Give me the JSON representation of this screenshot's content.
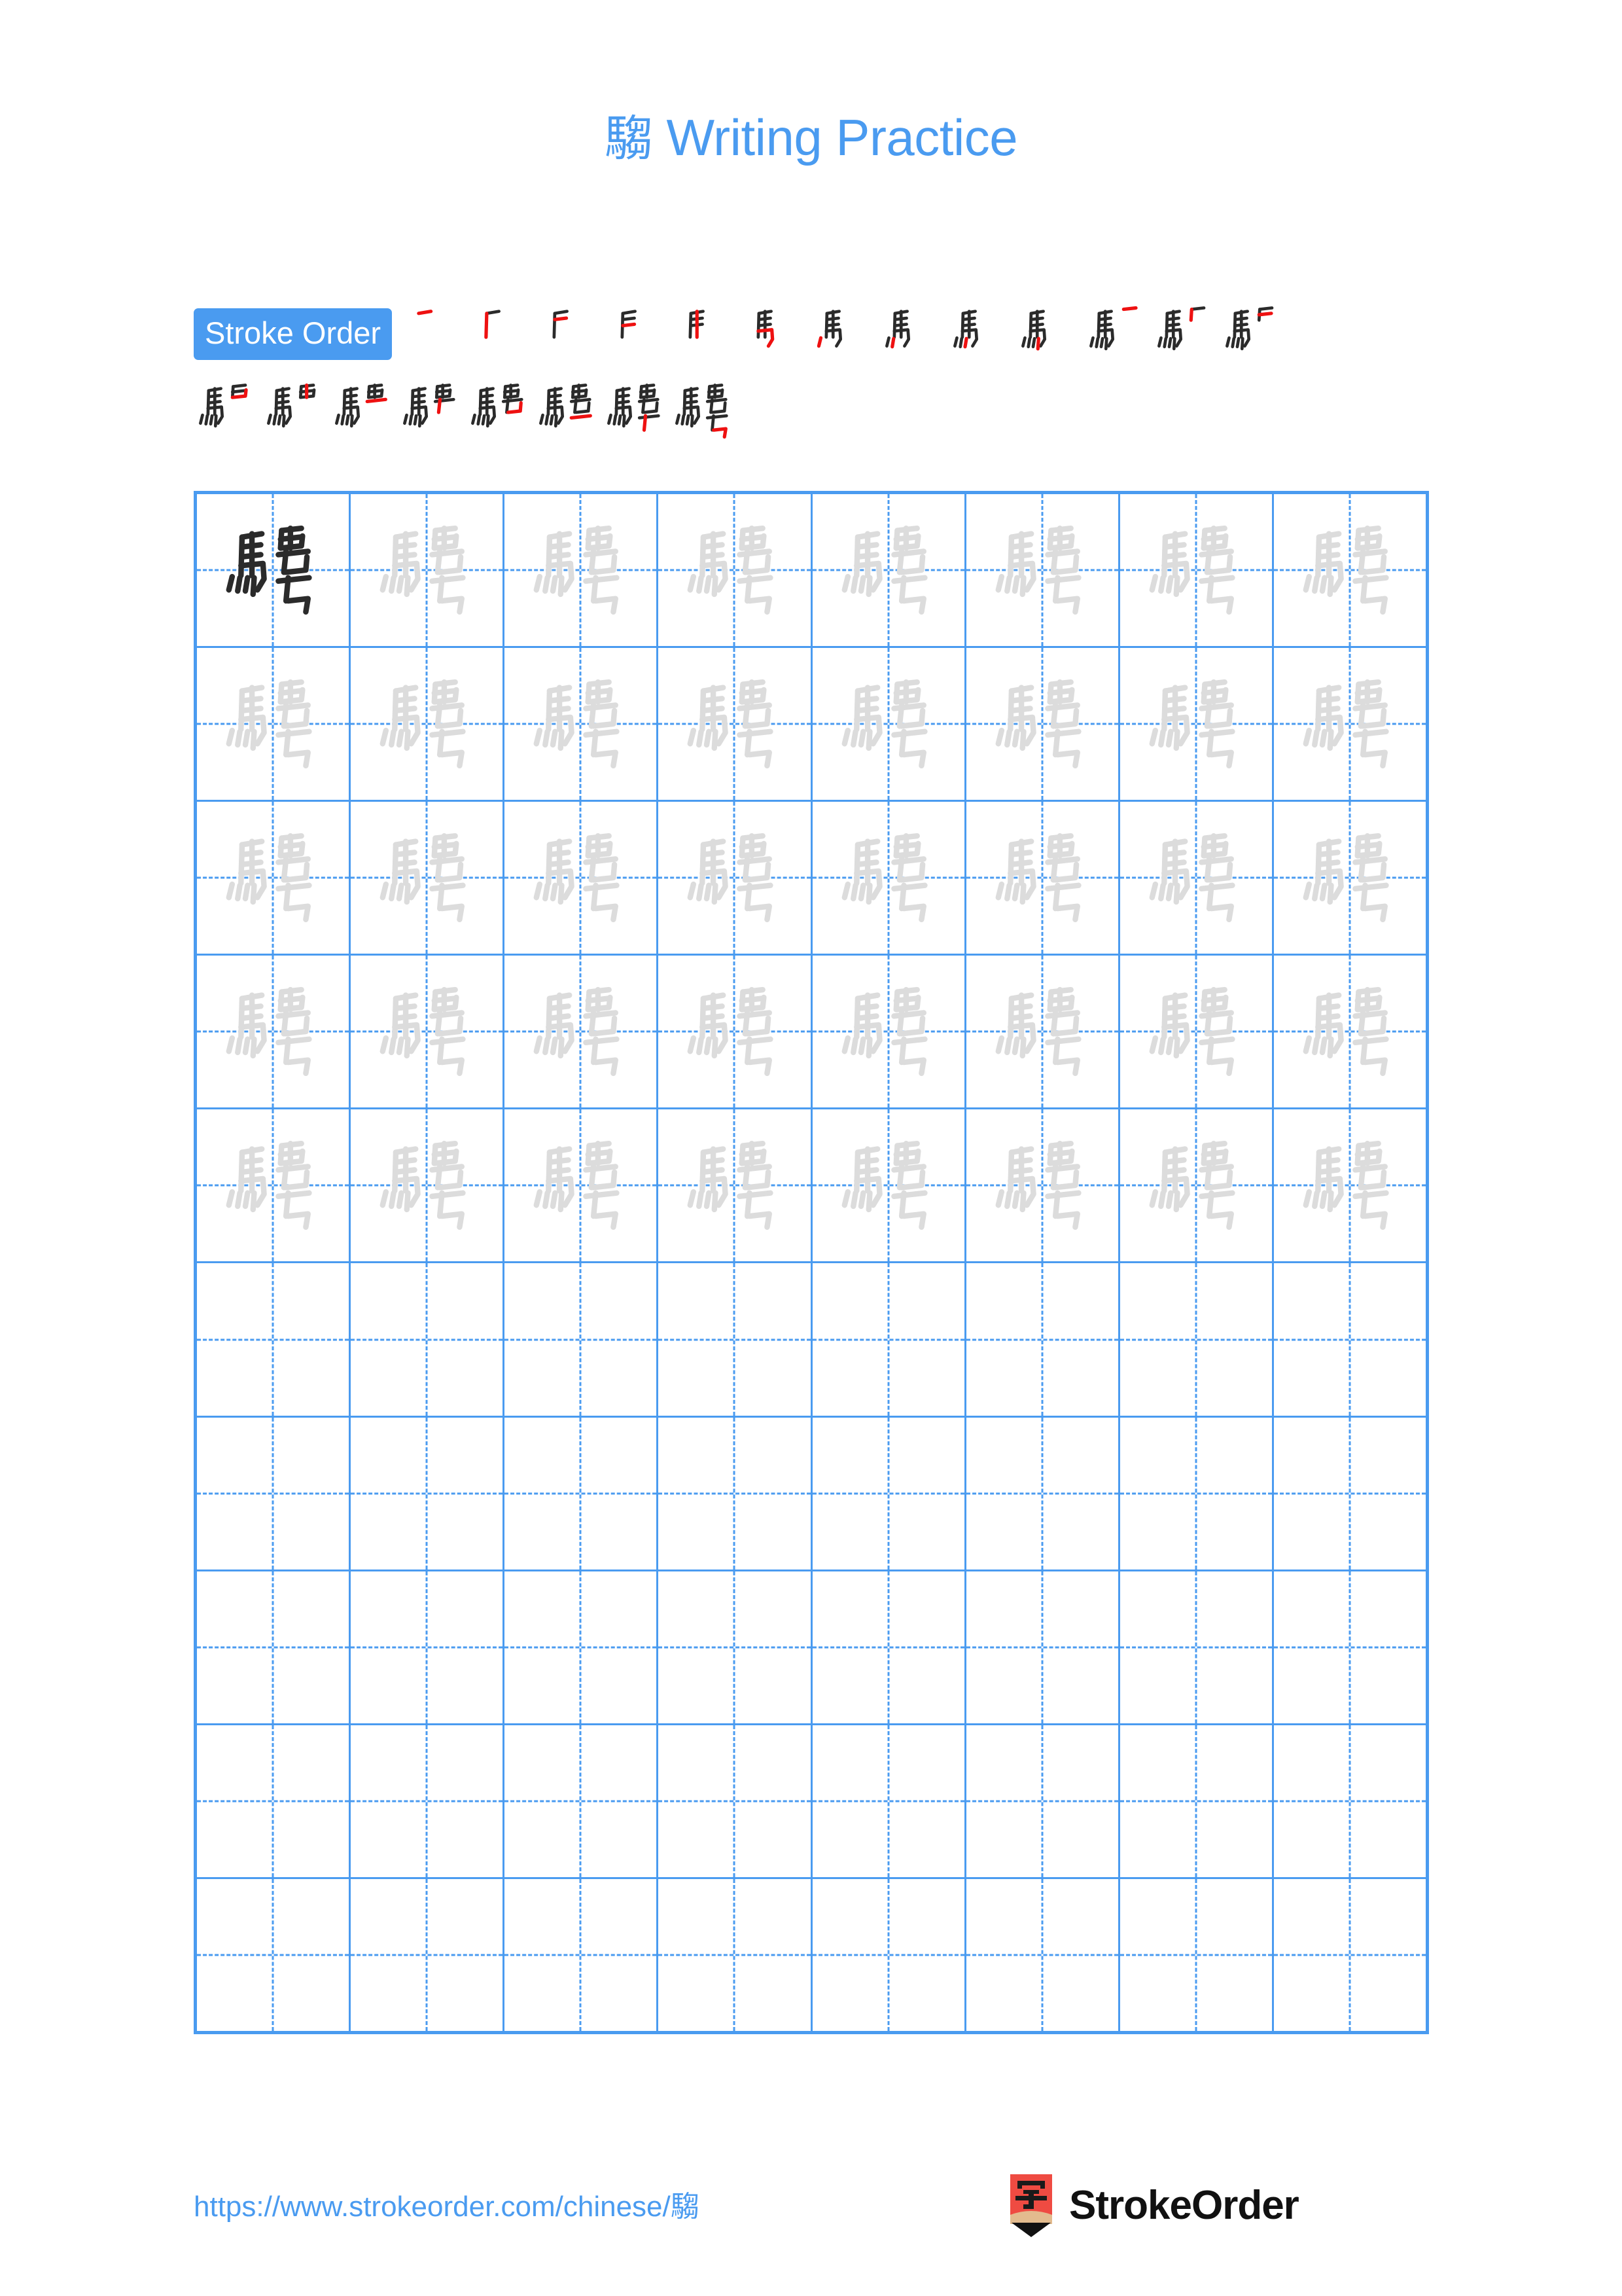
{
  "page": {
    "character": "騶",
    "title_suffix": " Writing Practice",
    "title_full": "騶 Writing Practice",
    "background_color": "#ffffff",
    "accent_color": "#4a9bf0",
    "trace_color": "#dcdcdc",
    "ink_color": "#2b2b2b",
    "new_stroke_color": "#ee1111"
  },
  "stroke_order": {
    "badge_label": "Stroke Order",
    "total_strokes": 21,
    "row1_count": 13,
    "row2_count": 8,
    "steps": [
      {
        "index": 1,
        "strokes_shown": 1
      },
      {
        "index": 2,
        "strokes_shown": 2
      },
      {
        "index": 3,
        "strokes_shown": 3
      },
      {
        "index": 4,
        "strokes_shown": 4
      },
      {
        "index": 5,
        "strokes_shown": 5
      },
      {
        "index": 6,
        "strokes_shown": 6
      },
      {
        "index": 7,
        "strokes_shown": 7
      },
      {
        "index": 8,
        "strokes_shown": 8
      },
      {
        "index": 9,
        "strokes_shown": 9
      },
      {
        "index": 10,
        "strokes_shown": 10
      },
      {
        "index": 11,
        "strokes_shown": 11
      },
      {
        "index": 12,
        "strokes_shown": 12
      },
      {
        "index": 13,
        "strokes_shown": 13
      },
      {
        "index": 14,
        "strokes_shown": 14
      },
      {
        "index": 15,
        "strokes_shown": 15
      },
      {
        "index": 16,
        "strokes_shown": 16
      },
      {
        "index": 17,
        "strokes_shown": 17
      },
      {
        "index": 18,
        "strokes_shown": 18
      },
      {
        "index": 19,
        "strokes_shown": 19
      },
      {
        "index": 20,
        "strokes_shown": 20
      },
      {
        "index": 21,
        "strokes_shown": 21
      }
    ]
  },
  "practice_grid": {
    "columns": 8,
    "rows": 10,
    "filled_rows": 5,
    "empty_rows": 5,
    "first_cell_style": "solid",
    "trace_cell_style": "outline-gray",
    "cell_character": "騶"
  },
  "footer": {
    "url": "https://www.strokeorder.com/chinese/騶",
    "brand_name": "StrokeOrder",
    "logo_character": "字",
    "logo_body_color": "#ef4b42",
    "logo_wood_color": "#e3bb8e",
    "logo_tip_color": "#111111"
  }
}
